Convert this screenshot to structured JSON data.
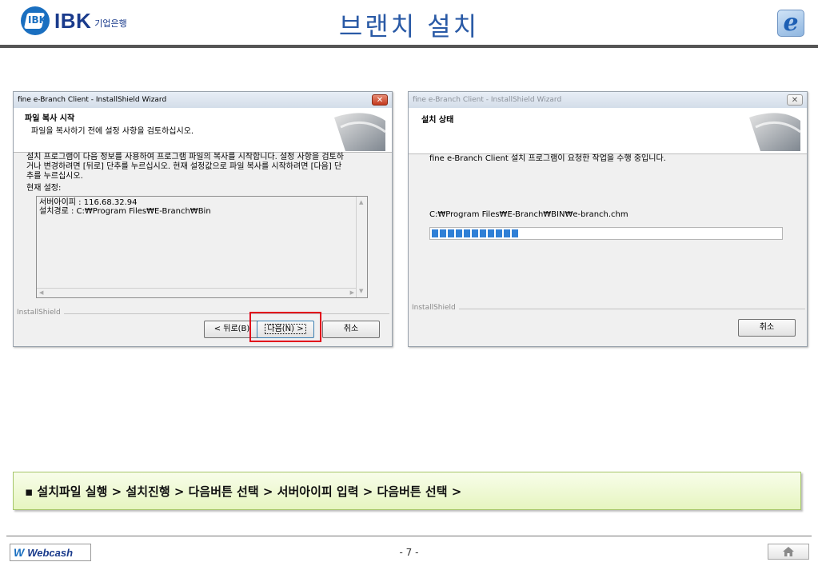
{
  "header": {
    "logo_badge": "IBK",
    "logo_text": "IBK",
    "logo_sub": "기업은행",
    "title": "브랜치 설치"
  },
  "icons": {
    "ie": "internet-explorer-icon",
    "home": "home-icon"
  },
  "dialog_copy": {
    "title": "fine e-Branch Client - InstallShield Wizard",
    "banner_title": "파일 복사 시작",
    "banner_sub": "파일을 복사하기 전에 설정 사항을 검토하십시오.",
    "description_1": "설치 프로그램이 다음 정보를 사용하여 프로그램 파일의 복사를 시작합니다. 설정 사항을 검토하",
    "description_2": "거나 변경하려면 [뒤로] 단추를 누르십시오. 현재 설정값으로 파일 복사를 시작하려면 [다음] 단",
    "description_3": "추를 누르십시오.",
    "settings_label": "현재 설정:",
    "setting_server": "서버아이피 : 116.68.32.94",
    "setting_path": "설치경로   : C:₩Program Files₩E-Branch₩Bin",
    "group_label": "InstallShield",
    "back_button": "< 뒤로(B)",
    "next_button": "다음(N) >",
    "cancel_button": "취소"
  },
  "dialog_status": {
    "title": "fine e-Branch Client - InstallShield Wizard",
    "banner_title": "설치 상태",
    "status_text": "fine e-Branch Client 설치 프로그램이 요청한 작업을 수행 중입니다.",
    "current_file": "C:₩Program Files₩E-Branch₩BIN₩e-branch.chm",
    "progress": 0.25,
    "group_label": "InstallShield",
    "cancel_button": "취소"
  },
  "notice": {
    "text": "▪ 설치파일 실행 > 설치진행 > 다음버튼 선택 > 서버아이피 입력 > 다음버튼 선택 >"
  },
  "footer": {
    "brand": "Webcash",
    "brand_mark": "W",
    "page_number": "- 7 -"
  },
  "colors": {
    "title_blue": "#2a5aa6",
    "highlight_red": "#e2001a",
    "progress_blue": "#2f7fd6",
    "notice_green": "#e6f5c0"
  }
}
